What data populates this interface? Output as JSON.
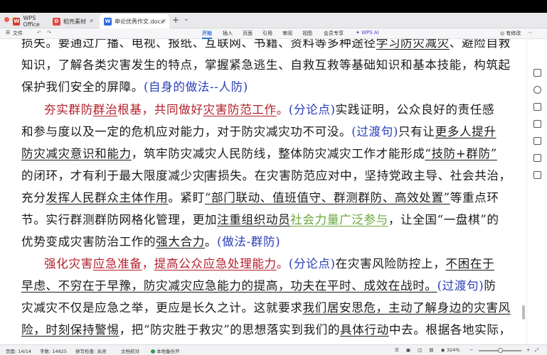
{
  "window": {
    "tabs": [
      {
        "label": "WPS Office",
        "icon": "wps-logo-icon",
        "color": "#d63b32"
      },
      {
        "label": "稻壳素材",
        "icon": "daoke-icon",
        "color": "#e0473e"
      },
      {
        "label": "申论优秀作文.docx",
        "icon": "word-doc-icon",
        "color": "#2c6be0"
      }
    ]
  },
  "toolbar": {
    "file": "文件",
    "menu": [
      "开始",
      "插入",
      "页面",
      "引用",
      "审阅",
      "视图",
      "会员专享"
    ],
    "ai": "WPS AI",
    "edit": "有修改",
    "accent": "#2c6be0"
  },
  "document": {
    "l1": [
      "损失。要通过广播、电视、报纸、互联网、书籍、资料等多种途径",
      "学习防灾减灾",
      "、避险自救"
    ],
    "l2": "知识，了解各类灾害发生的特点，掌握紧急逃生、自救互救等基础知识和基本技能，构筑起",
    "l3": [
      "保护我们安全的屏障。",
      "(自身的做法--人防)"
    ],
    "l4": [
      "夯实群防",
      "群治",
      "根基，共同做好",
      "灾害防范工作",
      "。",
      "(分论点)",
      "实践证明，公众良好的责任感"
    ],
    "l5": [
      "和参与度以及一定的危机应对能力，对于防灾减灾功不可没。",
      "(过渡句)",
      "只有让",
      "更多人提升"
    ],
    "l6": [
      "防灾减灾意识和能力",
      "，筑牢防灾减灾人民防线，整体防灾减灾工作才能形成",
      "“技防+群防”"
    ],
    "l7": [
      "的闭环，才有利于最大限度减少灾",
      "害损失。在灾害防范应对中，坚持党政主导、社会共治，"
    ],
    "l8": [
      "充分",
      "发挥人民群众主体作用",
      "。紧盯",
      "“部门联动、值班值守、群测群防、高效处置”",
      "等重点环"
    ],
    "l9": [
      "节。实行群测群防网格化管理，更加",
      "注重组织动员",
      "社会力量广泛参与",
      "，让全国“一盘棋”的"
    ],
    "l10": [
      "优势变成灾害防治工作的",
      "强大合力",
      "。",
      "(做法-群防)"
    ],
    "l11": [
      "强化灾害",
      "应急准备",
      "，",
      "提高公众应急处理能力",
      "。",
      "(分论点)",
      "在灾害风险防控上，",
      "不困在于"
    ],
    "l12": [
      "早虑、不穷在于早豫，防灾减灾应急能力的提高，功夫在平时、成效在战时。",
      "(过渡句)",
      "防"
    ],
    "l13": [
      "灾减灾不仅是应急之举，更应是长久之计。这就要求",
      "我们居安思危，主动了解身边的灾害风"
    ],
    "l14": [
      "险，时刻保持警惕",
      "，把“防灾胜于救灾”的思想落实到我们的",
      "具体行动",
      "中去。根据各地实际，"
    ]
  },
  "colors": {
    "red": "#b3202a",
    "blue": "#2a3eb8",
    "green": "#6aa83a"
  },
  "status": {
    "page": "页面: 14/14",
    "words": "字数: 14925",
    "spell": "拼写检查: 关闭",
    "proof": "文档校对",
    "backup": "本地备份开",
    "zoom": "324%"
  }
}
